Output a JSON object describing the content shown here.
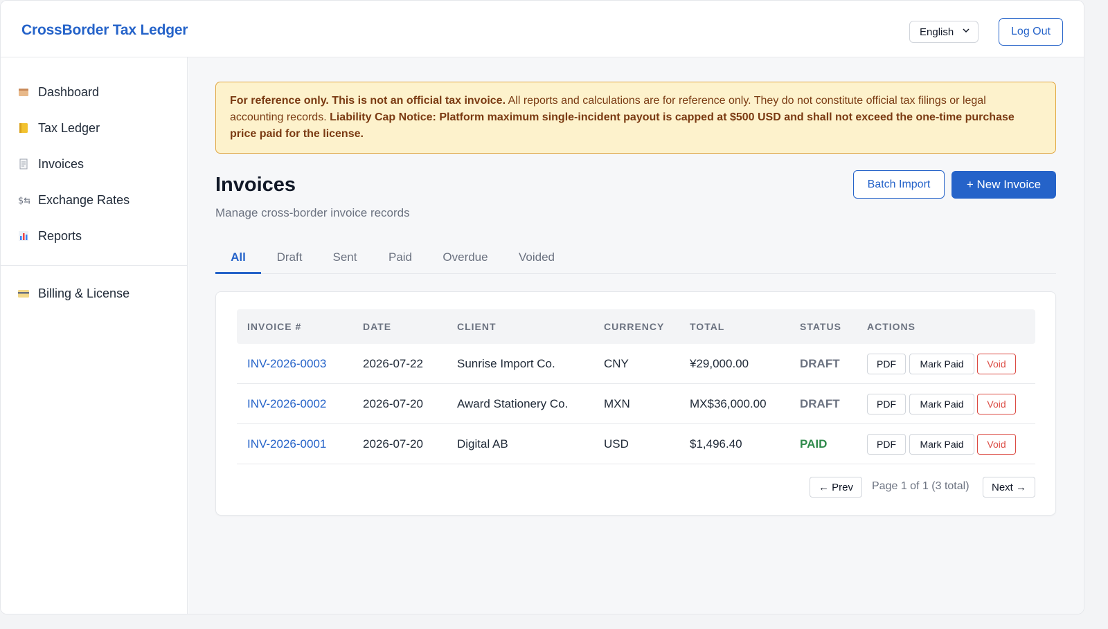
{
  "app": {
    "brand": "CrossBorder Tax Ledger"
  },
  "header": {
    "language": "English",
    "logout_label": "Log Out"
  },
  "sidebar": {
    "items": [
      {
        "label": "Dashboard",
        "icon": "dashboard-icon"
      },
      {
        "label": "Tax Ledger",
        "icon": "ledger-icon"
      },
      {
        "label": "Invoices",
        "icon": "invoice-icon"
      },
      {
        "label": "Exchange Rates",
        "icon": "exchange-icon"
      },
      {
        "label": "Reports",
        "icon": "chart-icon"
      }
    ],
    "billing": {
      "label": "Billing & License",
      "icon": "card-icon"
    }
  },
  "notice": {
    "bold1": "For reference only. This is not an official tax invoice.",
    "text1": " All reports and calculations are for reference only. They do not constitute official tax filings or legal accounting records. ",
    "bold2": "Liability Cap Notice: Platform maximum single-incident payout is capped at $500 USD and shall not exceed the one-time purchase price paid for the license."
  },
  "page": {
    "title": "Invoices",
    "subtitle": "Manage cross-border invoice records",
    "batch_import_label": "Batch Import",
    "new_invoice_label": "+ New Invoice"
  },
  "tabs": [
    "All",
    "Draft",
    "Sent",
    "Paid",
    "Overdue",
    "Voided"
  ],
  "table": {
    "headers": [
      "INVOICE #",
      "DATE",
      "CLIENT",
      "CURRENCY",
      "TOTAL",
      "STATUS",
      "ACTIONS"
    ],
    "rows": [
      {
        "invoice": "INV-2026-0003",
        "date": "2026-07-22",
        "client": "Sunrise Import Co.",
        "currency": "CNY",
        "total": "¥29,000.00",
        "status": "DRAFT"
      },
      {
        "invoice": "INV-2026-0002",
        "date": "2026-07-20",
        "client": "Award Stationery Co.",
        "currency": "MXN",
        "total": "MX$36,000.00",
        "status": "DRAFT"
      },
      {
        "invoice": "INV-2026-0001",
        "date": "2026-07-20",
        "client": "Digital AB",
        "currency": "USD",
        "total": "$1,496.40",
        "status": "PAID"
      }
    ],
    "actions": {
      "pdf": "PDF",
      "mark_paid": "Mark Paid",
      "void": "Void"
    }
  },
  "pagination": {
    "prev": "← Prev",
    "info": "Page 1 of 1 (3 total)",
    "next": "Next →"
  },
  "colors": {
    "accent": "#2563c9",
    "notice_bg": "#fdf2cc",
    "notice_border": "#e0a640",
    "paid": "#2f8a4b",
    "void": "#dc4b43"
  }
}
